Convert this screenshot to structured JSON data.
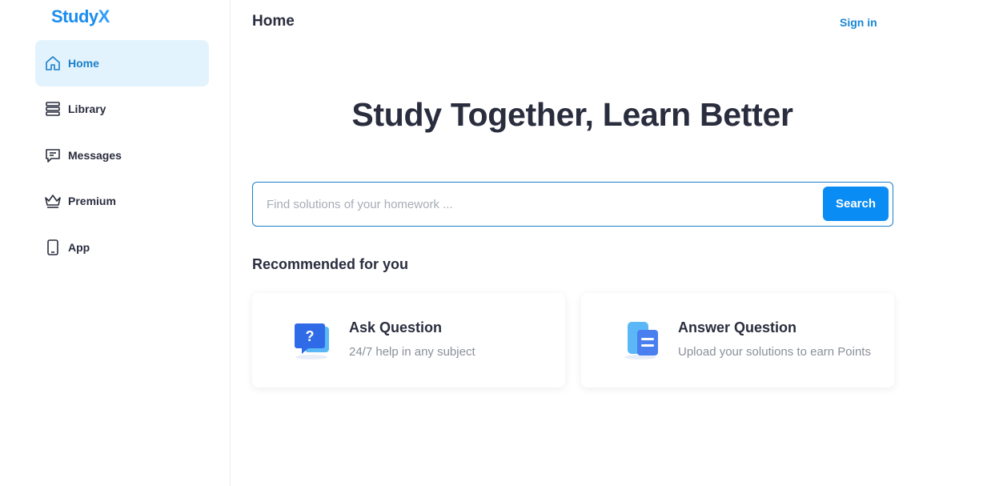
{
  "brand": {
    "name_main": "Study",
    "name_accent": "X"
  },
  "sidebar": {
    "items": [
      {
        "label": "Home",
        "icon": "home-icon",
        "active": true
      },
      {
        "label": "Library",
        "icon": "library-icon",
        "active": false
      },
      {
        "label": "Messages",
        "icon": "messages-icon",
        "active": false
      },
      {
        "label": "Premium",
        "icon": "crown-icon",
        "active": false
      },
      {
        "label": "App",
        "icon": "phone-icon",
        "active": false
      }
    ]
  },
  "header": {
    "title": "Home",
    "signin_label": "Sign in"
  },
  "hero": {
    "headline": "Study Together, Learn Better"
  },
  "search": {
    "placeholder": "Find solutions of your homework ...",
    "value": "",
    "button_label": "Search"
  },
  "recommended": {
    "title": "Recommended for you",
    "cards": [
      {
        "title": "Ask Question",
        "description": "24/7 help in any subject",
        "icon": "ask-question-icon"
      },
      {
        "title": "Answer Question",
        "description": "Upload your solutions to earn Points",
        "icon": "answer-question-icon"
      }
    ]
  },
  "colors": {
    "accent": "#0a8cf5",
    "active_bg": "#e3f3fd",
    "active_text": "#1a7fc9",
    "text": "#2a2d3e",
    "muted": "#8a8f9a"
  }
}
